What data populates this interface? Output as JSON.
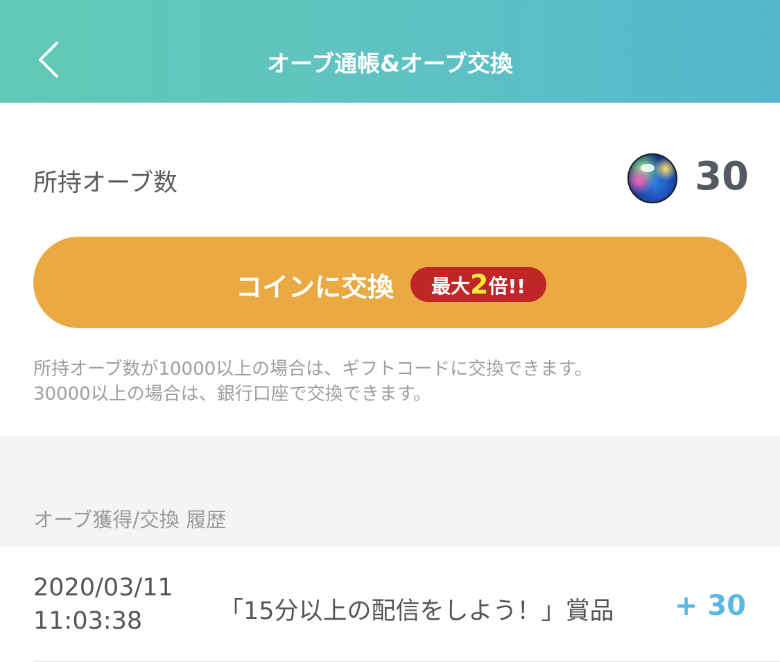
{
  "header": {
    "title": "オーブ通帳&オーブ交換",
    "back_icon": "chevron-left-icon"
  },
  "balance": {
    "label": "所持オーブ数",
    "count": "30",
    "icon": "orb-icon"
  },
  "exchange": {
    "button_label": "コインに交換",
    "badge_prefix": "最大",
    "badge_number": "2",
    "badge_suffix": "倍!!",
    "button_color": "#eba943",
    "badge_color": "#c02626"
  },
  "notes": [
    "所持オーブ数が10000以上の場合は、ギフトコードに交換できます。",
    "30000以上の場合は、銀行口座で交換できます。"
  ],
  "history": {
    "section_title": "オーブ獲得/交換 履歴",
    "rows": [
      {
        "date": "2020/03/11",
        "time": "11:03:38",
        "description": "「15分以上の配信をしよう！」賞品",
        "amount": "+ 30"
      }
    ]
  },
  "colors": {
    "header_gradient_start": "#63c9b5",
    "header_gradient_end": "#56b7cc",
    "amount": "#5cb8de"
  }
}
